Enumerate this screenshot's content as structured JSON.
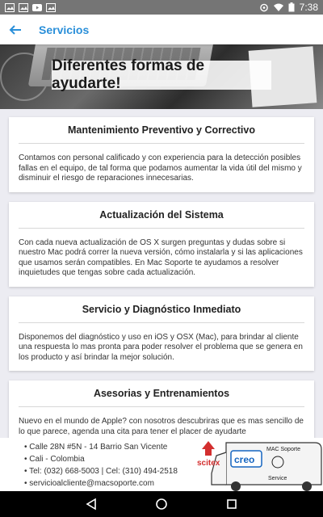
{
  "status_bar": {
    "time": "7:38",
    "icons": [
      "image-icon",
      "image-icon",
      "youtube-icon",
      "image-icon",
      "sync-icon",
      "wifi-icon",
      "battery-icon"
    ]
  },
  "app_bar": {
    "title": "Servicios",
    "accent_color": "#2a8fd9"
  },
  "hero": {
    "text": "Diferentes formas de ayudarte!"
  },
  "services": [
    {
      "title": "Mantenimiento Preventivo y Correctivo",
      "description": " Contamos con personal calificado y con experiencia para la detección posibles fallas en el equipo, de tal forma que podamos aumentar la vida útil del mismo y disminuir el riesgo de reparaciones innecesarias."
    },
    {
      "title": "Actualización del Sistema",
      "description": " Con cada nueva actualización de OS X surgen preguntas y dudas sobre si nuestro Mac podrá correr la nueva versión, cómo instalarla y si las aplicaciones que usamos serán compatibles. En Mac Soporte te ayudamos a resolver inquietudes que tengas sobre cada actualización."
    },
    {
      "title": "Servicio y Diagnóstico Inmediato",
      "description": " Disponemos del diagnóstico y uso en iOS y OSX (Mac), para brindar al cliente una respuesta lo mas pronta para poder resolver el problema que se genera en los producto y así brindar la mejor  solución."
    },
    {
      "title": "Asesorias y Entrenamientos",
      "description": " Nuevo en el mundo de Apple? con nosotros descubriras que es mas sencillo de lo que parece, agenda una cita para tener el placer de ayudarte"
    }
  ],
  "footer": {
    "lines": [
      "Calle 28N #5N - 14 Barrio San Vicente",
      "Cali - Colombia",
      "Tel: (032) 668-5003 | Cel: (310) 494-2518",
      "servicioalcliente@macsoporte.com"
    ],
    "logo_scitex": "scitex",
    "logo_creo": "creo",
    "van_text_top": "MAC Soporte",
    "van_text_bottom": "Service"
  },
  "nav_bar": {
    "icons": [
      "back-triangle-icon",
      "home-circle-icon",
      "recents-square-icon"
    ]
  }
}
